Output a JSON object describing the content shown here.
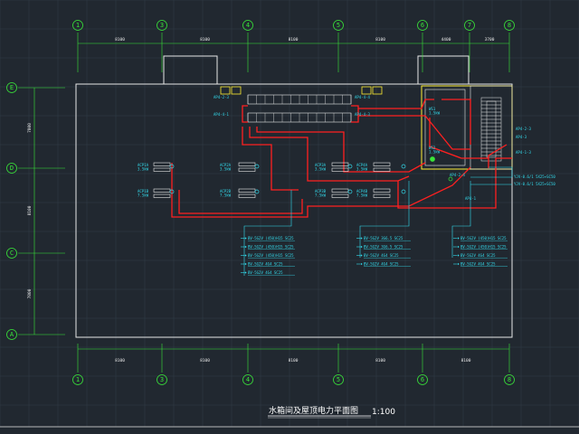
{
  "title": "水箱间及屋顶电力平面图",
  "scale": "1:100",
  "axes_top": [
    "1",
    "3",
    "4",
    "5",
    "6",
    "7",
    "8"
  ],
  "axes_bottom": [
    "1",
    "3",
    "4",
    "5",
    "6",
    "8"
  ],
  "axes_left": [
    "E",
    "D",
    "C",
    "A"
  ],
  "dims_top": [
    "8100",
    "8100",
    "8100",
    "8100",
    "4400",
    "3700"
  ],
  "dims_bottom": [
    "8100",
    "8100",
    "8100",
    "8100",
    "8100"
  ],
  "dims_left": [
    "7800",
    "8100",
    "7800"
  ],
  "panels": {
    "ap_3_top": "AP4-2-3",
    "ap_3_bot": "AP4-4-1",
    "ap_4_top": "AP4-4-4",
    "ap_4_bot": "AP4-4-3",
    "ap_right_1": "AP4-2-3",
    "ap_right_2": "AP4-3",
    "ap_right_3": "AP4-1-3",
    "ap_right_4": "AP4-1",
    "ap_center_stair": "AP4-2-4"
  },
  "circuit_labels": {
    "left_1": [
      "BV-5G2V (450)H15 SC25",
      "BV-5G2V (450)H15 SC25",
      "BV-5G2V (450)H15 SC25",
      "BV-5G2V 4G4 SC25",
      "BV-5G2V 4G4 SC25"
    ],
    "mid_1": [
      "BV-5G2V 3G6.5 SC25",
      "BV-5G2V 3G6.5 SC25",
      "BV-5G2V 4G4 SC25",
      "BV-5G2V 4G4 SC25"
    ],
    "right_1": [
      "BV-5G2V (450)H15 SC25",
      "BV-5G2V (450)H15 SC25",
      "BV-5G2V 4G4 SC25",
      "BV-5G2V 4G4 SC25"
    ],
    "right_feed": [
      "YJV-0.6/1 5X25+SC50",
      "YJV-0.6/1 5X25+SC50"
    ]
  },
  "equipment_labels": {
    "eq_a": "ACP1A\n3.5kW",
    "eq_b": "ACP1B\n7.5kW",
    "eq_c": "ACP2A\n3.5kW",
    "eq_d": "ACP2B\n7.5kW",
    "eq_e": "ACP3A\n3.5kW",
    "eq_f": "ACP3B\n7.5kW",
    "eq_g": "ACP4A\n3.5kW",
    "eq_h": "ACP4B\n7.5kW",
    "stair_a": "WS1\n1.5kW",
    "stair_b": "WS2\n1.5kW"
  },
  "colors": {
    "background": "#212830",
    "grid_line": "#3a4350",
    "axis_green": "#39e639",
    "wall_white": "#e8e8e8",
    "wire_red": "#ff2020",
    "label_cyan": "#33ddee",
    "panel_yellow": "#ffee33"
  }
}
